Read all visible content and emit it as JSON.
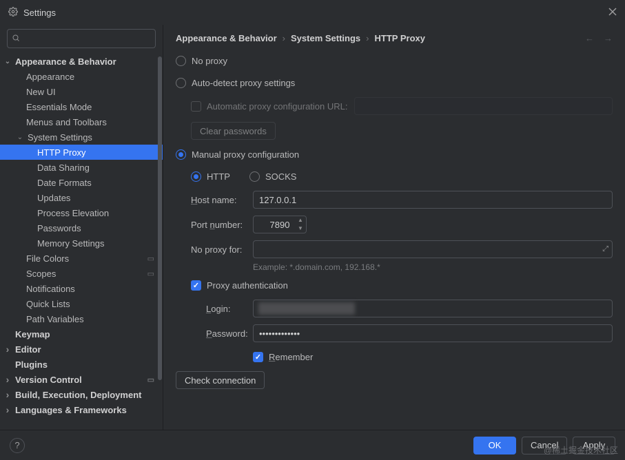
{
  "window": {
    "title": "Settings"
  },
  "search": {
    "placeholder": ""
  },
  "tree": {
    "appearance_behavior": "Appearance & Behavior",
    "appearance": "Appearance",
    "new_ui": "New UI",
    "essentials_mode": "Essentials Mode",
    "menus_toolbars": "Menus and Toolbars",
    "system_settings": "System Settings",
    "http_proxy": "HTTP Proxy",
    "data_sharing": "Data Sharing",
    "date_formats": "Date Formats",
    "updates": "Updates",
    "process_elevation": "Process Elevation",
    "passwords": "Passwords",
    "memory_settings": "Memory Settings",
    "file_colors": "File Colors",
    "scopes": "Scopes",
    "notifications": "Notifications",
    "quick_lists": "Quick Lists",
    "path_variables": "Path Variables",
    "keymap": "Keymap",
    "editor": "Editor",
    "plugins": "Plugins",
    "version_control": "Version Control",
    "build": "Build, Execution, Deployment",
    "languages": "Languages & Frameworks"
  },
  "breadcrumb": {
    "a": "Appearance & Behavior",
    "b": "System Settings",
    "c": "HTTP Proxy"
  },
  "proxy": {
    "no_proxy": "No proxy",
    "auto_detect": "Auto-detect proxy settings",
    "auto_url": "Automatic proxy configuration URL:",
    "clear_passwords": "Clear passwords",
    "manual": "Manual proxy configuration",
    "http": "HTTP",
    "socks": "SOCKS",
    "host_label": "Host name:",
    "host_value": "127.0.0.1",
    "port_label": "Port number:",
    "port_value": "7890",
    "no_proxy_for": "No proxy for:",
    "no_proxy_for_value": "",
    "example": "Example: *.domain.com, 192.168.*",
    "auth": "Proxy authentication",
    "login_label": "Login:",
    "login_value": "",
    "password_label": "Password:",
    "password_value": "•••••••••••••",
    "remember": "Remember",
    "check": "Check connection"
  },
  "footer": {
    "ok": "OK",
    "cancel": "Cancel",
    "apply": "Apply"
  },
  "watermark": "@稀土掘金技术社区"
}
